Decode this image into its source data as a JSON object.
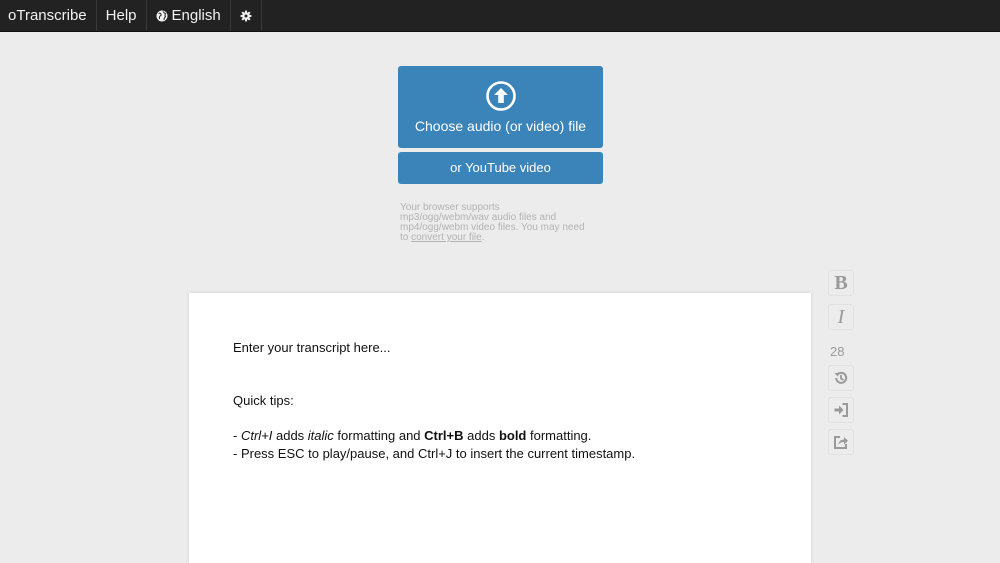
{
  "nav": {
    "app_name": "oTranscribe",
    "help": "Help",
    "language": "English",
    "globe_icon": "globe-icon",
    "settings_icon": "gear-icon"
  },
  "upload": {
    "file_button_label": "Choose audio (or video) file",
    "upload_icon": "upload-arrow-icon",
    "youtube_button_label": "or YouTube video",
    "support_text": "Your browser supports mp3/ogg/webm/wav audio files and mp4/ogg/webm video files. You may need to ",
    "convert_link": "convert your file",
    "support_text_end": "."
  },
  "editor": {
    "placeholder_line": "Enter your transcript here...",
    "tips_heading": "Quick tips:",
    "tip1": {
      "dash": "- ",
      "key1": "Ctrl+I",
      "text1": " adds ",
      "word1": "italic",
      "text2": " formatting and ",
      "key2": "Ctrl+B",
      "text3": " adds ",
      "word2": "bold",
      "text4": " formatting."
    },
    "tip2": "- Press ESC to play/pause, and Ctrl+J to insert the current timestamp."
  },
  "sidebar": {
    "bold_label": "B",
    "italic_label": "I",
    "speed_value": "28",
    "icons": [
      "history-icon",
      "sign-in-icon",
      "share-icon"
    ]
  },
  "colors": {
    "topbar": "#222222",
    "accent": "#3a84b9",
    "background": "#ececec"
  }
}
